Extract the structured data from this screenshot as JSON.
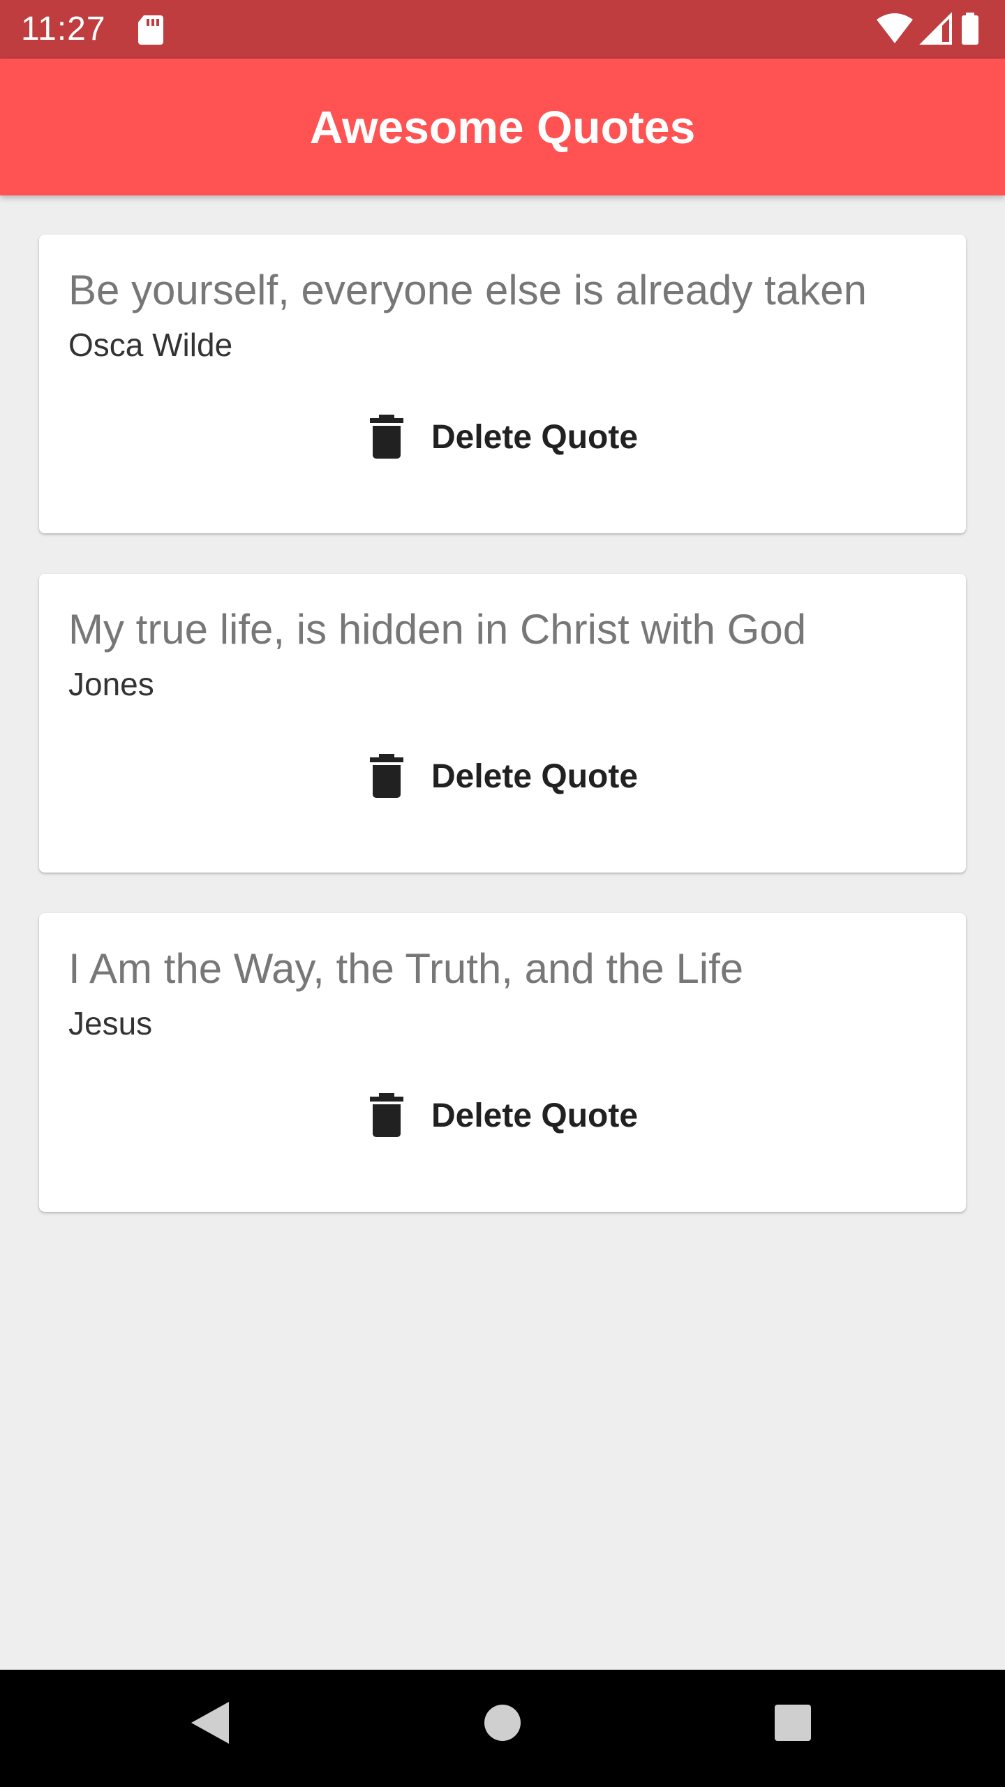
{
  "status_bar": {
    "time": "11:27",
    "icons": [
      "sd-card-icon",
      "wifi-icon",
      "cell-signal-icon",
      "battery-icon"
    ]
  },
  "app_bar": {
    "title": "Awesome Quotes",
    "color": "#ff5252"
  },
  "quotes": [
    {
      "text": "Be yourself, everyone else is already taken",
      "author": "Osca Wilde",
      "delete_label": "Delete Quote"
    },
    {
      "text": "My true life, is hidden in Christ with God",
      "author": "Jones",
      "delete_label": "Delete Quote"
    },
    {
      "text": "I Am the Way, the Truth, and the Life",
      "author": "Jesus",
      "delete_label": "Delete Quote"
    }
  ],
  "nav_bar": {
    "buttons": [
      "back-icon",
      "home-icon",
      "recents-icon"
    ]
  }
}
